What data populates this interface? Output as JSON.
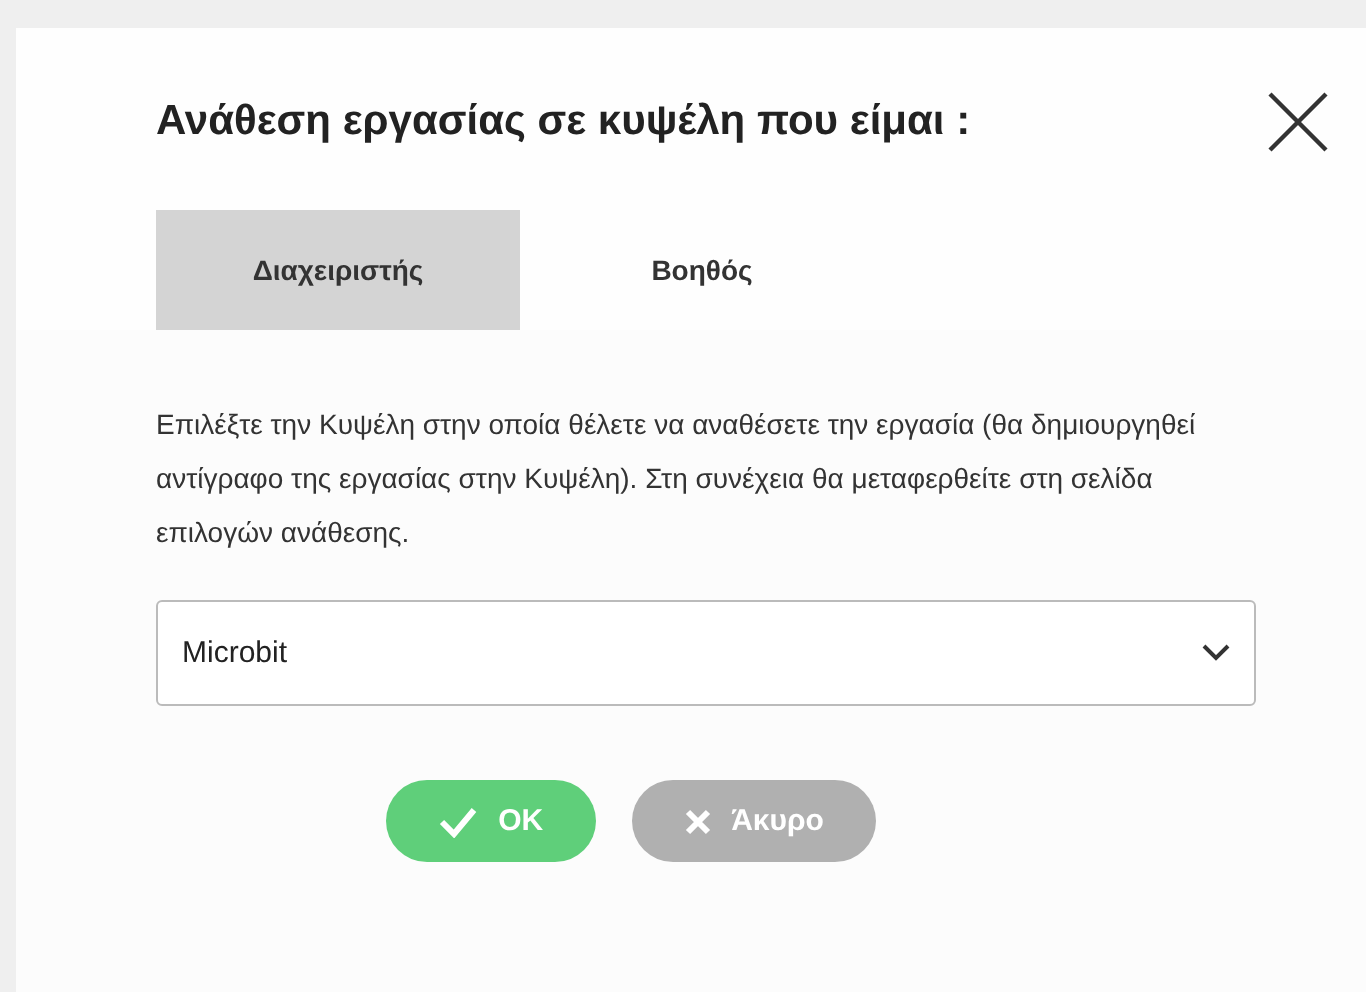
{
  "dialog": {
    "title": "Ανάθεση εργασίας σε κυψέλη που είμαι :",
    "tabs": [
      {
        "label": "Διαχειριστής",
        "selected": true
      },
      {
        "label": "Βοηθός",
        "selected": false
      }
    ],
    "description": "Επιλέξτε την Κυψέλη στην οποία θέλετε να αναθέσετε την εργασία (θα δημιουργηθεί αντίγραφο της εργασίας στην Κυψέλη). Στη συνέχεια θα μεταφερθείτε στη σελίδα επιλογών ανάθεσης.",
    "select": {
      "value": "Microbit"
    },
    "buttons": [
      {
        "kind": "ok",
        "label": "OK"
      },
      {
        "kind": "cancel",
        "label": "Άκυρο"
      }
    ]
  }
}
